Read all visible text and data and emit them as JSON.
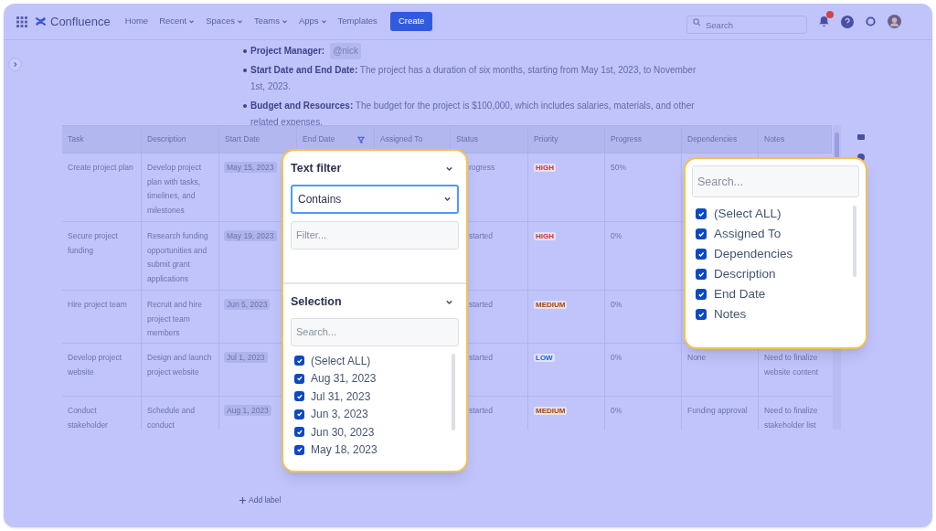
{
  "nav": {
    "product": "Confluence",
    "links": [
      {
        "label": "Home",
        "menu": false
      },
      {
        "label": "Recent",
        "menu": true
      },
      {
        "label": "Spaces",
        "menu": true
      },
      {
        "label": "Teams",
        "menu": true
      },
      {
        "label": "Apps",
        "menu": true
      },
      {
        "label": "Templates",
        "menu": false
      }
    ],
    "create": "Create",
    "search_placeholder": "Search"
  },
  "bullets": [
    {
      "label": "Project Manager:",
      "mention": "@nick"
    },
    {
      "label": "Start Date and End Date:",
      "text": "The project has a duration of six months, starting from May 1st, 2023, to November 1st, 2023."
    },
    {
      "label": "Budget and Resources:",
      "text": "The budget for the project is $100,000, which includes salaries, materials, and other related expenses."
    }
  ],
  "table": {
    "columns": [
      {
        "label": "Task",
        "filtered": false
      },
      {
        "label": "Description",
        "filtered": false
      },
      {
        "label": "Start Date",
        "filtered": false
      },
      {
        "label": "End Date",
        "filtered": true
      },
      {
        "label": "Assigned To",
        "filtered": false
      },
      {
        "label": "Status",
        "filtered": false
      },
      {
        "label": "Priority",
        "filtered": false
      },
      {
        "label": "Progress",
        "filtered": false
      },
      {
        "label": "Dependencies",
        "filtered": false
      },
      {
        "label": "Notes",
        "filtered": false
      }
    ],
    "rows": [
      {
        "task": "Create project plan",
        "description": "Develop project plan with tasks, timelines, and milestones",
        "start_date": "May 15, 2023",
        "status": "rogress",
        "priority": {
          "label": "HIGH",
          "color": "#c9372c"
        },
        "progress": "50%"
      },
      {
        "task": "Secure project funding",
        "description": "Research funding opportunities and submit grant applications",
        "start_date": "May 19, 2023",
        "status": "started",
        "priority": {
          "label": "HIGH",
          "color": "#c9372c"
        },
        "progress": "0%"
      },
      {
        "task": "Hire project team",
        "description": "Recruit and hire project team members",
        "start_date": "Jun 5, 2023",
        "status": "started",
        "priority": {
          "label": "MEDIUM",
          "color": "#a54800"
        },
        "progress": "0%"
      },
      {
        "task": "Develop project website",
        "description": "Design and launch project website",
        "start_date": "Jul 1, 2023",
        "status": "started",
        "priority": {
          "label": "LOW",
          "color": "#0c66e4"
        },
        "progress": "0%",
        "dependencies": "None",
        "notes": "Need to finalize website content"
      },
      {
        "task": "Conduct stakeholder",
        "description": "Schedule and conduct",
        "start_date": "Aug 1, 2023",
        "status": "started",
        "priority": {
          "label": "MEDIUM",
          "color": "#a54800"
        },
        "progress": "0%",
        "dependencies": "Funding approval",
        "notes": "Need to finalize stakeholder list"
      }
    ]
  },
  "filter_popup": {
    "text_filter": {
      "title": "Text filter",
      "operator": "Contains",
      "placeholder": "Filter..."
    },
    "selection": {
      "title": "Selection",
      "search_placeholder": "Search...",
      "items": [
        {
          "label": "(Select ALL)",
          "checked": true
        },
        {
          "label": "Aug 31, 2023",
          "checked": true
        },
        {
          "label": "Jul 31, 2023",
          "checked": true
        },
        {
          "label": "Jun 3, 2023",
          "checked": true
        },
        {
          "label": "Jun 30, 2023",
          "checked": true
        },
        {
          "label": "May 18, 2023",
          "checked": true
        }
      ]
    }
  },
  "columns_popup": {
    "search_placeholder": "Search...",
    "items": [
      {
        "label": "(Select ALL)",
        "checked": true
      },
      {
        "label": "Assigned To",
        "checked": true
      },
      {
        "label": "Dependencies",
        "checked": true
      },
      {
        "label": "Description",
        "checked": true
      },
      {
        "label": "End Date",
        "checked": true
      },
      {
        "label": "Notes",
        "checked": true
      }
    ]
  },
  "add_label": "Add label"
}
